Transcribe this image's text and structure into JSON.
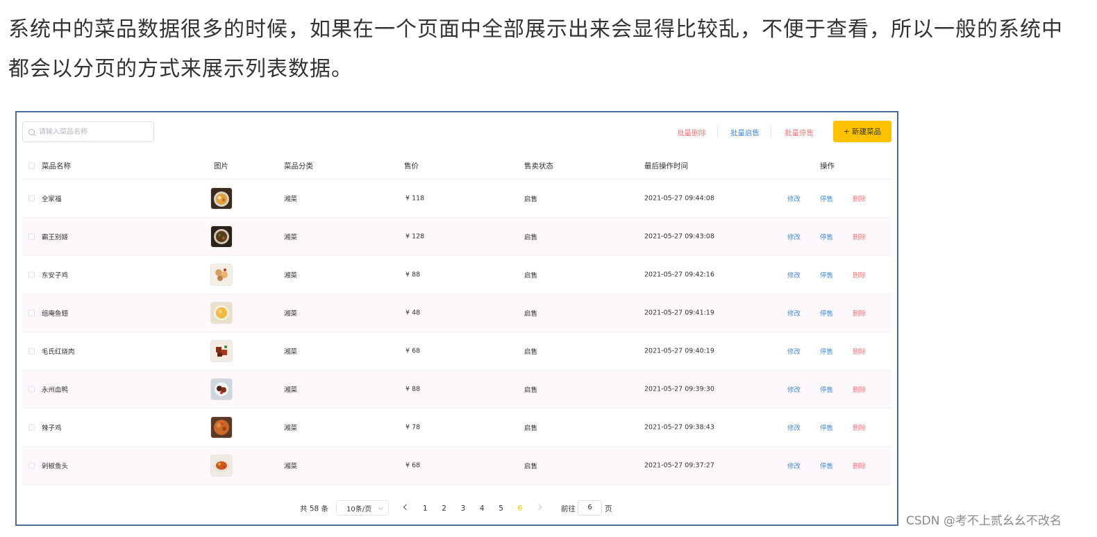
{
  "intro": {
    "line1": "系统中的菜品数据很多的时候，如果在一个页面中全部展示出来会显得比较乱，不便于查看，所以一般的系统中",
    "line2": "都会以分页的方式来展示列表数据。"
  },
  "toolbar": {
    "search_placeholder": "请输入菜品名称",
    "batch_delete": "批量删除",
    "batch_enable": "批量启售",
    "batch_disable": "批量停售",
    "new_dish": "+ 新建菜品"
  },
  "table": {
    "columns": [
      "菜品名称",
      "图片",
      "菜品分类",
      "售价",
      "售卖状态",
      "最后操作时间",
      "操作"
    ],
    "actions": {
      "edit": "修改",
      "stop": "停售",
      "delete": "删除"
    },
    "rows": [
      {
        "name": "全家福",
        "category": "湘菜",
        "price": "¥ 118",
        "status": "启售",
        "time": "2021-05-27 09:44:08",
        "img": "food-bowl-orange"
      },
      {
        "name": "霸王别姬",
        "category": "湘菜",
        "price": "¥ 128",
        "status": "启售",
        "time": "2021-05-27 09:43:08",
        "img": "food-stew-dark"
      },
      {
        "name": "东安子鸡",
        "category": "湘菜",
        "price": "¥ 88",
        "status": "启售",
        "time": "2021-05-27 09:42:16",
        "img": "food-chicken-pieces"
      },
      {
        "name": "组庵鱼翅",
        "category": "湘菜",
        "price": "¥ 48",
        "status": "启售",
        "time": "2021-05-27 09:41:19",
        "img": "food-soup-yellow"
      },
      {
        "name": "毛氏红烧肉",
        "category": "湘菜",
        "price": "¥ 68",
        "status": "启售",
        "time": "2021-05-27 09:40:19",
        "img": "food-braised-pork"
      },
      {
        "name": "永州血鸭",
        "category": "湘菜",
        "price": "¥ 88",
        "status": "启售",
        "time": "2021-05-27 09:39:30",
        "img": "food-duck-dark"
      },
      {
        "name": "辣子鸡",
        "category": "湘菜",
        "price": "¥ 78",
        "status": "启售",
        "time": "2021-05-27 09:38:43",
        "img": "food-spicy-chicken"
      },
      {
        "name": "剁椒鱼头",
        "category": "湘菜",
        "price": "¥ 68",
        "status": "启售",
        "time": "2021-05-27 09:37:27",
        "img": "food-fish-head"
      }
    ]
  },
  "pagination": {
    "total": "共 58 条",
    "page_size": "10条/页",
    "pages": [
      "1",
      "2",
      "3",
      "4",
      "5",
      "6"
    ],
    "current_page": "6",
    "goto_label": "前往",
    "goto_value": "6",
    "page_suffix": "页"
  },
  "watermark": "CSDN @考不上贰幺幺不改名",
  "colors": {
    "accent": "#ffc200",
    "link": "#4a8ccf",
    "danger": "#ee7a7a",
    "current_page": "#ffc200",
    "panel_border": "#4a6a9a"
  }
}
